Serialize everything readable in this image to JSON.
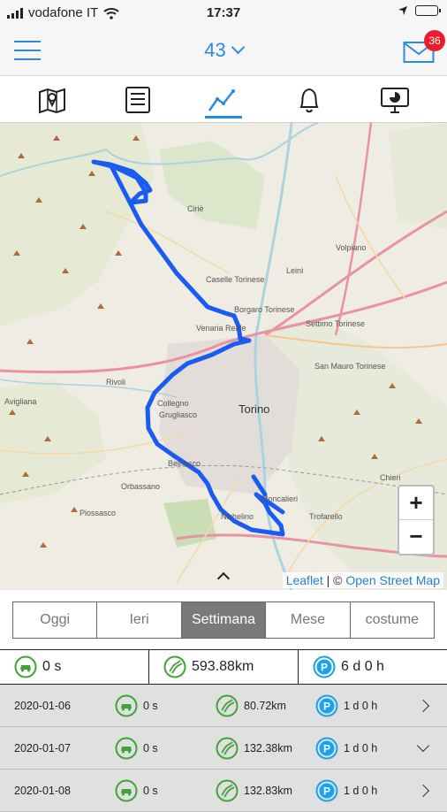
{
  "status_bar": {
    "carrier": "vodafone IT",
    "time": "17:37"
  },
  "header": {
    "title": "43",
    "mail_badge": "36"
  },
  "tabs": [
    {
      "name": "map-tab",
      "icon": "map-marker-icon"
    },
    {
      "name": "list-tab",
      "icon": "list-icon"
    },
    {
      "name": "chart-tab",
      "icon": "line-chart-icon",
      "active": true
    },
    {
      "name": "alerts-tab",
      "icon": "bell-icon"
    },
    {
      "name": "report-tab",
      "icon": "monitor-chart-icon"
    }
  ],
  "map": {
    "labels": {
      "torino": "Torino",
      "venaria": "Venaria Reale",
      "collegno": "Collegno",
      "grugliasco": "Grugliasco",
      "rivoli": "Rivoli",
      "orbassano": "Orbassano",
      "piossasco": "Piossasco",
      "caselle": "Caselle Torinese",
      "borgaro": "Borgaro Torinese",
      "leini": "Leinì",
      "settimo": "Settimo Torinese",
      "chieri": "Chieri",
      "moncalieri": "Moncalieri",
      "nichelino": "Nichelino",
      "volpiano": "Volpiano",
      "ciriè": "Ciriè",
      "sanmauro": "San Mauro Torinese",
      "trofarello": "Trofarello",
      "beinasco": "Beinasco",
      "avigliana": "Avigliana"
    },
    "zoom_in": "+",
    "zoom_out": "−",
    "attribution_leaflet": "Leaflet",
    "attribution_sep": " | © ",
    "attribution_osm": "Open Street Map"
  },
  "periods": [
    "Oggi",
    "Ieri",
    "Settimana",
    "Mese",
    "costume"
  ],
  "active_period": "Settimana",
  "summary": {
    "moving": "0 s",
    "distance": "593.88km",
    "parking": "6 d 0 h"
  },
  "days": [
    {
      "date": "2020-01-06",
      "moving": "0 s",
      "distance": "80.72km",
      "parking": "1 d 0 h",
      "expanded": false
    },
    {
      "date": "2020-01-07",
      "moving": "0 s",
      "distance": "132.38km",
      "parking": "1 d 0 h",
      "expanded": true
    },
    {
      "date": "2020-01-08",
      "moving": "0 s",
      "distance": "132.83km",
      "parking": "1 d 0 h",
      "expanded": false
    }
  ],
  "colors": {
    "accent": "#2a8ae6",
    "route": "#1a5cf0",
    "badge": "#ea1e2b",
    "status_green": "#3fa535",
    "parking_blue": "#1aa3e8"
  }
}
